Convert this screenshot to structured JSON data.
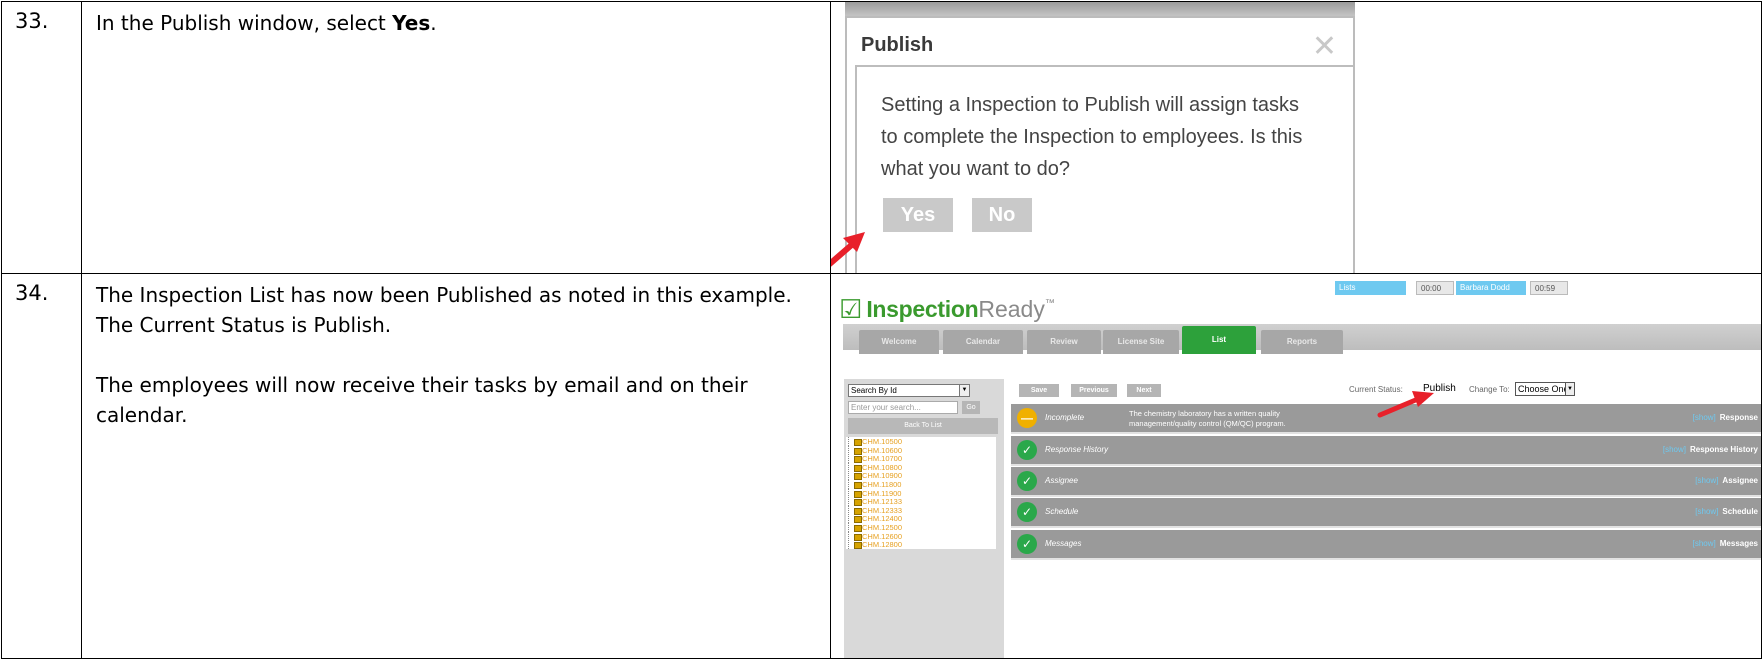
{
  "steps": [
    {
      "number": "33.",
      "text_before": "In the Publish window, select ",
      "text_bold": "Yes",
      "text_after": "."
    },
    {
      "number": "34.",
      "para1": "The Inspection List has now been Published as noted in this example. The Current Status is Publish.",
      "para2": "The employees will now receive their tasks by email and on their calendar."
    }
  ],
  "publish_dialog": {
    "title": "Publish",
    "message": "Setting a Inspection to Publish will assign tasks to complete the Inspection to employees. Is this what you want to do?",
    "yes_label": "Yes",
    "no_label": "No",
    "close_icon": "close-icon"
  },
  "app": {
    "logo_part1": "Inspection",
    "logo_part2": "Ready",
    "logo_tm": "™",
    "top": {
      "lists": "Lists",
      "time1": "00:00",
      "user": "Barbara Dodd",
      "time2": "00:59"
    },
    "tabs": [
      "Welcome",
      "Calendar",
      "Review",
      "License Site",
      "List",
      "Reports"
    ],
    "active_tab": "List",
    "search_select": "Search By Id",
    "search_placeholder": "Enter your search...",
    "go_label": "Go",
    "back_label": "Back To List",
    "tree_items": [
      "CHM.10500",
      "CHM.10600",
      "CHM.10700",
      "CHM.10800",
      "CHM.10900",
      "CHM.11800",
      "CHM.11900",
      "CHM.12133",
      "CHM.12333",
      "CHM.12400",
      "CHM.12500",
      "CHM.12600",
      "CHM.12800"
    ],
    "toolbar": {
      "save": "Save",
      "previous": "Previous",
      "next": "Next"
    },
    "current_status_label": "Current Status:",
    "current_status_value": "Publish",
    "change_to_label": "Change To:",
    "change_to_value": "Choose One",
    "show_label": "[show]",
    "rows": [
      {
        "name": "Incomplete",
        "desc": "The chemistry laboratory has a written quality management/quality control (QM/QC) program.",
        "right": "Response",
        "status": "warn"
      },
      {
        "name": "Response History",
        "desc": "",
        "right": "Response History",
        "status": "ok"
      },
      {
        "name": "Assignee",
        "desc": "",
        "right": "Assignee",
        "status": "ok"
      },
      {
        "name": "Schedule",
        "desc": "",
        "right": "Schedule",
        "status": "ok"
      },
      {
        "name": "Messages",
        "desc": "",
        "right": "Messages",
        "status": "ok"
      }
    ]
  },
  "colors": {
    "accent_green": "#2da13b",
    "arrow_red": "#e8202a",
    "tab_blue": "#6ec9f0"
  }
}
